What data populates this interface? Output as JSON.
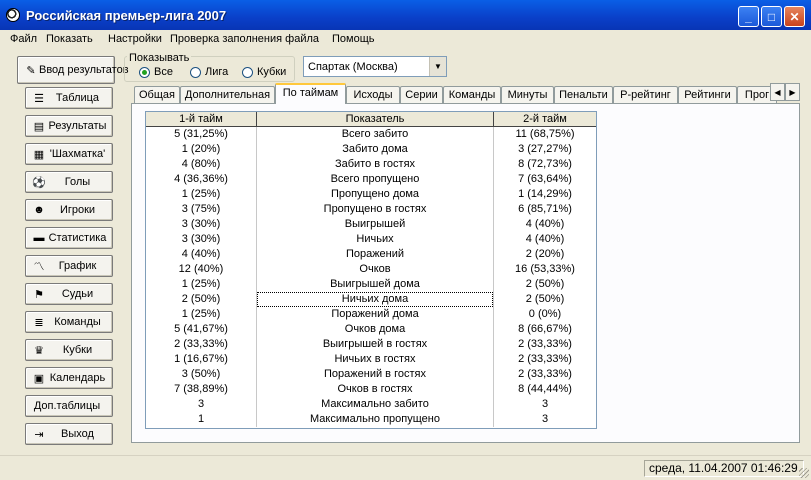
{
  "window": {
    "title": "Российская премьер-лига 2007",
    "minimize": "_",
    "maximize": "□",
    "close": "✕"
  },
  "menu": [
    "Файл",
    "Показать",
    "Настройки",
    "Проверка заполнения файла",
    "Помощь"
  ],
  "nav": {
    "intro": "Ввод результатов",
    "items": [
      {
        "label": "Таблица",
        "icon": "list-icon",
        "glyph": "☰"
      },
      {
        "label": "Результаты",
        "icon": "results-icon",
        "glyph": "▤"
      },
      {
        "label": "'Шахматка'",
        "icon": "chessboard-icon",
        "glyph": "▦"
      },
      {
        "label": "Голы",
        "icon": "soccer-ball-icon",
        "glyph": "⚽"
      },
      {
        "label": "Игроки",
        "icon": "players-icon",
        "glyph": "☻"
      },
      {
        "label": "Статистика",
        "icon": "statistics-icon",
        "glyph": "▬"
      },
      {
        "label": "График",
        "icon": "chart-icon",
        "glyph": "〽"
      },
      {
        "label": "Судьи",
        "icon": "referees-icon",
        "glyph": "⚑"
      },
      {
        "label": "Команды",
        "icon": "teams-icon",
        "glyph": "≣"
      },
      {
        "label": "Кубки",
        "icon": "cups-icon",
        "glyph": "♛"
      },
      {
        "label": "Календарь",
        "icon": "calendar-icon",
        "glyph": "▣"
      },
      {
        "label": "Доп.таблицы",
        "icon": "",
        "glyph": ""
      },
      {
        "label": "Выход",
        "icon": "exit-icon",
        "glyph": "⇥"
      }
    ]
  },
  "show": {
    "legend": "Показывать",
    "options": [
      "Все",
      "Лига",
      "Кубки"
    ],
    "selected": "Все"
  },
  "team_select": {
    "value": "Спартак (Москва)"
  },
  "tabs": [
    "Общая",
    "Дополнительная",
    "По таймам",
    "Исходы",
    "Серии",
    "Команды",
    "Минуты",
    "Пенальти",
    "Р-рейтинг",
    "Рейтинги",
    "Прог"
  ],
  "active_tab": "По таймам",
  "grid": {
    "headers": [
      "1-й тайм",
      "Показатель",
      "2-й тайм"
    ],
    "rows": [
      [
        "5 (31,25%)",
        "Всего забито",
        "11 (68,75%)"
      ],
      [
        "1 (20%)",
        "Забито дома",
        "3 (27,27%)"
      ],
      [
        "4 (80%)",
        "Забито в гостях",
        "8 (72,73%)"
      ],
      [
        "4 (36,36%)",
        "Всего пропущено",
        "7 (63,64%)"
      ],
      [
        "1 (25%)",
        "Пропущено дома",
        "1 (14,29%)"
      ],
      [
        "3 (75%)",
        "Пропущено в гостях",
        "6 (85,71%)"
      ],
      [
        "3 (30%)",
        "Выигрышей",
        "4 (40%)"
      ],
      [
        "3 (30%)",
        "Ничьих",
        "4 (40%)"
      ],
      [
        "4 (40%)",
        "Поражений",
        "2 (20%)"
      ],
      [
        "12 (40%)",
        "Очков",
        "16 (53,33%)"
      ],
      [
        "1 (25%)",
        "Выигрышей дома",
        "2 (50%)"
      ],
      [
        "2 (50%)",
        "Ничьих дома",
        "2 (50%)"
      ],
      [
        "1 (25%)",
        "Поражений дома",
        "0 (0%)"
      ],
      [
        "5 (41,67%)",
        "Очков дома",
        "8 (66,67%)"
      ],
      [
        "2 (33,33%)",
        "Выигрышей в гостях",
        "2 (33,33%)"
      ],
      [
        "1 (16,67%)",
        "Ничьих в гостях",
        "2 (33,33%)"
      ],
      [
        "3 (50%)",
        "Поражений в гостях",
        "2 (33,33%)"
      ],
      [
        "7 (38,89%)",
        "Очков в гостях",
        "8 (44,44%)"
      ],
      [
        "3",
        "Максимально забито",
        "3"
      ],
      [
        "1",
        "Максимально пропущено",
        "3"
      ]
    ],
    "selected_row": 11
  },
  "status": {
    "datetime": "среда, 11.04.2007 01:46:29"
  }
}
